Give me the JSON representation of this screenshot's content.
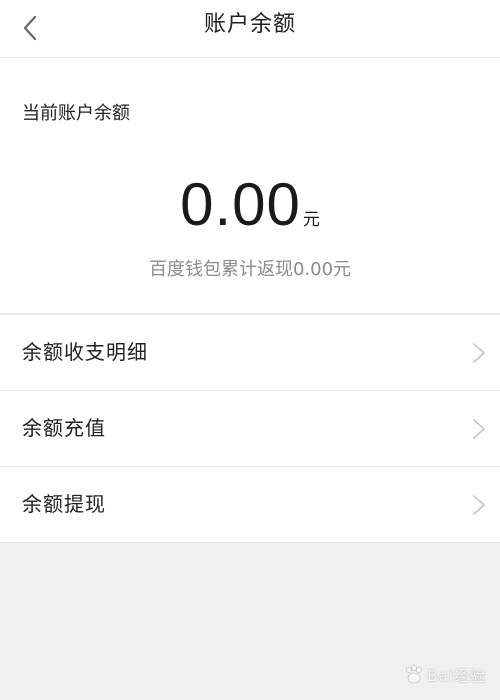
{
  "header": {
    "title": "账户余额",
    "back_icon": "chevron-left-icon"
  },
  "balance": {
    "label": "当前账户余额",
    "amount": "0.00",
    "unit": "元",
    "cashback_text": "百度钱包累计返现0.00元"
  },
  "menu": {
    "items": [
      {
        "label": "余额收支明细",
        "icon": "chevron-right-icon"
      },
      {
        "label": "余额充值",
        "icon": "chevron-right-icon"
      },
      {
        "label": "余额提现",
        "icon": "chevron-right-icon"
      }
    ]
  },
  "watermark": {
    "text": "Bai经验"
  },
  "colors": {
    "page_background": "#f0f0f0",
    "card_background": "#ffffff",
    "divider": "#e6e6e6",
    "primary_text": "#222222",
    "secondary_text": "#8c8c8c",
    "chevron": "#c8c8c8"
  }
}
